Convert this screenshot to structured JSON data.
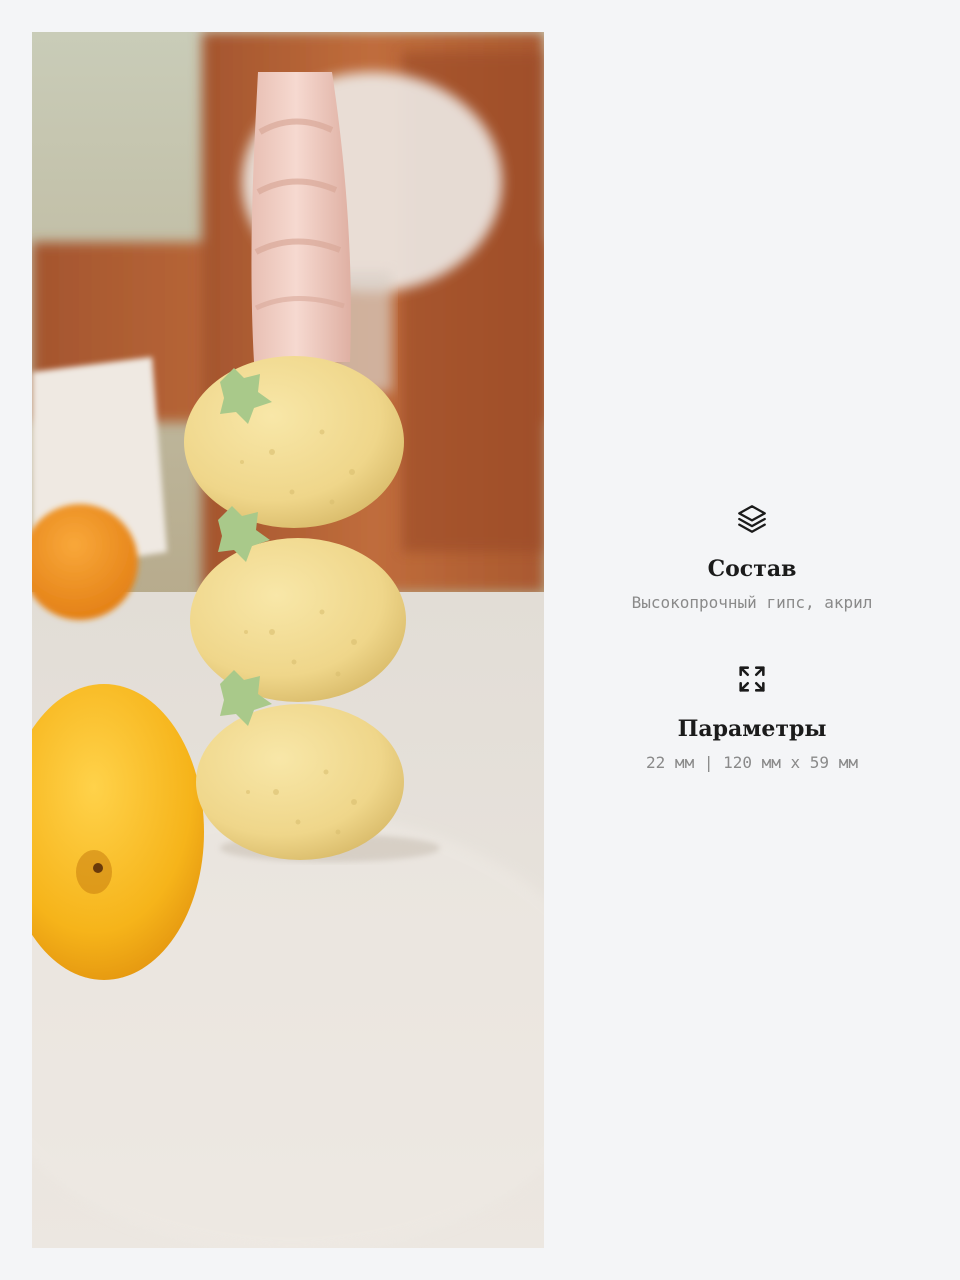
{
  "photo": {
    "subject": "candle-holder-photo",
    "colors": {
      "background_wood": "#b6653a",
      "table_surface": "#e9e4de",
      "holder_yellow": "#f0d98c",
      "leaf_green": "#a9c98a",
      "candle_pink": "#f1cfc5",
      "lemon": "#f6b81a",
      "orange": "#f2951c"
    }
  },
  "features": {
    "composition": {
      "icon": "layers-icon",
      "title": "Состав",
      "value": "Высокопрочный гипс, акрил"
    },
    "params": {
      "icon": "expand-icon",
      "title": "Параметры",
      "value": "22 мм | 120 мм х 59 мм"
    }
  }
}
